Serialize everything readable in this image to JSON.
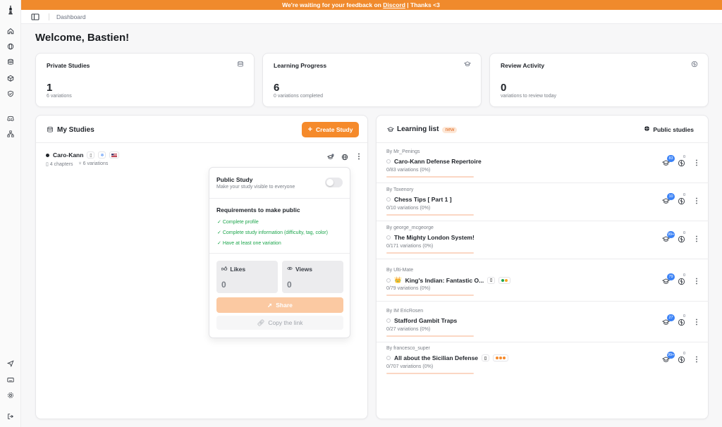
{
  "banner": {
    "text_before": "We're waiting for your feedback on ",
    "link": "Discord",
    "text_after": " | Thanks <3"
  },
  "breadcrumb": "Dashboard",
  "welcome": "Welcome, Bastien!",
  "stats": [
    {
      "title": "Private Studies",
      "value": "1",
      "sub": "6 variations",
      "icon": "database-icon"
    },
    {
      "title": "Learning Progress",
      "value": "6",
      "sub": "0 variations completed",
      "icon": "graduation-cap-icon"
    },
    {
      "title": "Review Activity",
      "value": "0",
      "sub": "variations to review today",
      "icon": "brain-icon"
    }
  ],
  "my_studies": {
    "title": "My Studies",
    "create_label": "Create Study",
    "study": {
      "name": "Caro-Kann",
      "chapters": "4 chapters",
      "variations": "6 variations"
    }
  },
  "popover": {
    "public_title": "Public Study",
    "public_sub": "Make your study visible to everyone",
    "public_enabled": false,
    "requirements_title": "Requirements to make public",
    "requirements": [
      "Complete profile",
      "Complete study information (difficulty, tag, color)",
      "Have at least one variation"
    ],
    "likes_label": "Likes",
    "likes_value": "0",
    "views_label": "Views",
    "views_value": "0",
    "share_label": "Share",
    "copy_label": "Copy the link"
  },
  "learning_list": {
    "title": "Learning list",
    "new_badge": "new",
    "public_studies_label": "Public studies",
    "items": [
      {
        "by": "By Mr_Penings",
        "name": "Caro-Kann Defense Repertoire",
        "progress": "0/83 variations (0%)",
        "count": "83",
        "review": "0",
        "has_book": false,
        "colors": [],
        "emoji": ""
      },
      {
        "by": "By Toxenory",
        "name": "Chess Tips [ Part 1 ]",
        "progress": "0/10 variations (0%)",
        "count": "10",
        "review": "0",
        "has_book": false,
        "colors": [],
        "emoji": ""
      },
      {
        "by": "By george_mcgeorge",
        "name": "The Mighty London System!",
        "progress": "0/171 variations (0%)",
        "count": "99+",
        "review": "0",
        "has_book": false,
        "colors": [],
        "emoji": ""
      },
      {
        "by": "By Ulti-Mate",
        "name": "King's Indian: Fantastic O...",
        "progress": "0/79 variations (0%)",
        "count": "79",
        "review": "0",
        "has_book": true,
        "colors": [
          "#1ea64d",
          "#f5a623"
        ],
        "emoji": "👑"
      },
      {
        "by": "By IM EricRosen",
        "name": "Stafford Gambit Traps",
        "progress": "0/27 variations (0%)",
        "count": "27",
        "review": "0",
        "has_book": false,
        "colors": [],
        "emoji": ""
      },
      {
        "by": "By francesco_super",
        "name": "All about the Sicilian Defense",
        "progress": "0/707 variations (0%)",
        "count": "99+",
        "review": "0",
        "has_book": true,
        "colors": [
          "#f58a2b",
          "#f58a2b",
          "#f58a2b"
        ],
        "emoji": ""
      }
    ]
  },
  "colors": {
    "accent": "#f58a2b",
    "banner": "#f08a2c",
    "success": "#1ea64d",
    "badge": "#3b82f6"
  }
}
